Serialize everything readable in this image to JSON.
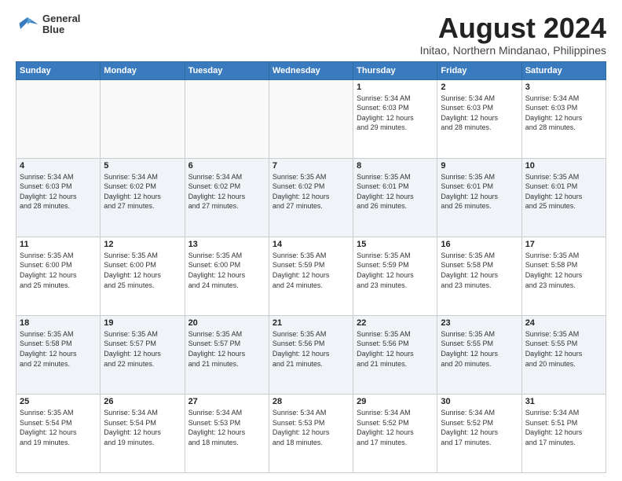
{
  "logo": {
    "line1": "General",
    "line2": "Blue"
  },
  "title": "August 2024",
  "subtitle": "Initao, Northern Mindanao, Philippines",
  "weekdays": [
    "Sunday",
    "Monday",
    "Tuesday",
    "Wednesday",
    "Thursday",
    "Friday",
    "Saturday"
  ],
  "weeks": [
    [
      {
        "day": "",
        "info": ""
      },
      {
        "day": "",
        "info": ""
      },
      {
        "day": "",
        "info": ""
      },
      {
        "day": "",
        "info": ""
      },
      {
        "day": "1",
        "info": "Sunrise: 5:34 AM\nSunset: 6:03 PM\nDaylight: 12 hours\nand 29 minutes."
      },
      {
        "day": "2",
        "info": "Sunrise: 5:34 AM\nSunset: 6:03 PM\nDaylight: 12 hours\nand 28 minutes."
      },
      {
        "day": "3",
        "info": "Sunrise: 5:34 AM\nSunset: 6:03 PM\nDaylight: 12 hours\nand 28 minutes."
      }
    ],
    [
      {
        "day": "4",
        "info": "Sunrise: 5:34 AM\nSunset: 6:03 PM\nDaylight: 12 hours\nand 28 minutes."
      },
      {
        "day": "5",
        "info": "Sunrise: 5:34 AM\nSunset: 6:02 PM\nDaylight: 12 hours\nand 27 minutes."
      },
      {
        "day": "6",
        "info": "Sunrise: 5:34 AM\nSunset: 6:02 PM\nDaylight: 12 hours\nand 27 minutes."
      },
      {
        "day": "7",
        "info": "Sunrise: 5:35 AM\nSunset: 6:02 PM\nDaylight: 12 hours\nand 27 minutes."
      },
      {
        "day": "8",
        "info": "Sunrise: 5:35 AM\nSunset: 6:01 PM\nDaylight: 12 hours\nand 26 minutes."
      },
      {
        "day": "9",
        "info": "Sunrise: 5:35 AM\nSunset: 6:01 PM\nDaylight: 12 hours\nand 26 minutes."
      },
      {
        "day": "10",
        "info": "Sunrise: 5:35 AM\nSunset: 6:01 PM\nDaylight: 12 hours\nand 25 minutes."
      }
    ],
    [
      {
        "day": "11",
        "info": "Sunrise: 5:35 AM\nSunset: 6:00 PM\nDaylight: 12 hours\nand 25 minutes."
      },
      {
        "day": "12",
        "info": "Sunrise: 5:35 AM\nSunset: 6:00 PM\nDaylight: 12 hours\nand 25 minutes."
      },
      {
        "day": "13",
        "info": "Sunrise: 5:35 AM\nSunset: 6:00 PM\nDaylight: 12 hours\nand 24 minutes."
      },
      {
        "day": "14",
        "info": "Sunrise: 5:35 AM\nSunset: 5:59 PM\nDaylight: 12 hours\nand 24 minutes."
      },
      {
        "day": "15",
        "info": "Sunrise: 5:35 AM\nSunset: 5:59 PM\nDaylight: 12 hours\nand 23 minutes."
      },
      {
        "day": "16",
        "info": "Sunrise: 5:35 AM\nSunset: 5:58 PM\nDaylight: 12 hours\nand 23 minutes."
      },
      {
        "day": "17",
        "info": "Sunrise: 5:35 AM\nSunset: 5:58 PM\nDaylight: 12 hours\nand 23 minutes."
      }
    ],
    [
      {
        "day": "18",
        "info": "Sunrise: 5:35 AM\nSunset: 5:58 PM\nDaylight: 12 hours\nand 22 minutes."
      },
      {
        "day": "19",
        "info": "Sunrise: 5:35 AM\nSunset: 5:57 PM\nDaylight: 12 hours\nand 22 minutes."
      },
      {
        "day": "20",
        "info": "Sunrise: 5:35 AM\nSunset: 5:57 PM\nDaylight: 12 hours\nand 21 minutes."
      },
      {
        "day": "21",
        "info": "Sunrise: 5:35 AM\nSunset: 5:56 PM\nDaylight: 12 hours\nand 21 minutes."
      },
      {
        "day": "22",
        "info": "Sunrise: 5:35 AM\nSunset: 5:56 PM\nDaylight: 12 hours\nand 21 minutes."
      },
      {
        "day": "23",
        "info": "Sunrise: 5:35 AM\nSunset: 5:55 PM\nDaylight: 12 hours\nand 20 minutes."
      },
      {
        "day": "24",
        "info": "Sunrise: 5:35 AM\nSunset: 5:55 PM\nDaylight: 12 hours\nand 20 minutes."
      }
    ],
    [
      {
        "day": "25",
        "info": "Sunrise: 5:35 AM\nSunset: 5:54 PM\nDaylight: 12 hours\nand 19 minutes."
      },
      {
        "day": "26",
        "info": "Sunrise: 5:34 AM\nSunset: 5:54 PM\nDaylight: 12 hours\nand 19 minutes."
      },
      {
        "day": "27",
        "info": "Sunrise: 5:34 AM\nSunset: 5:53 PM\nDaylight: 12 hours\nand 18 minutes."
      },
      {
        "day": "28",
        "info": "Sunrise: 5:34 AM\nSunset: 5:53 PM\nDaylight: 12 hours\nand 18 minutes."
      },
      {
        "day": "29",
        "info": "Sunrise: 5:34 AM\nSunset: 5:52 PM\nDaylight: 12 hours\nand 17 minutes."
      },
      {
        "day": "30",
        "info": "Sunrise: 5:34 AM\nSunset: 5:52 PM\nDaylight: 12 hours\nand 17 minutes."
      },
      {
        "day": "31",
        "info": "Sunrise: 5:34 AM\nSunset: 5:51 PM\nDaylight: 12 hours\nand 17 minutes."
      }
    ]
  ]
}
